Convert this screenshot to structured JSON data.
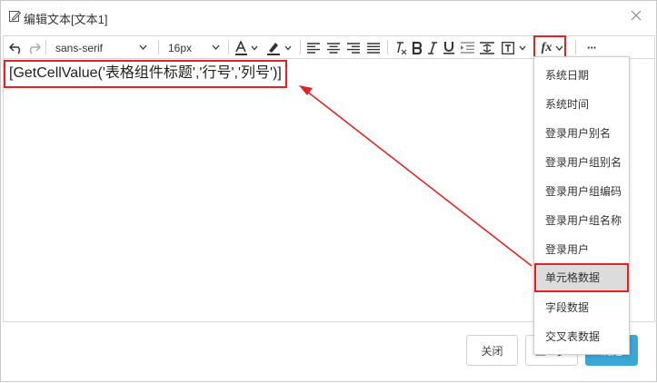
{
  "dialog": {
    "title": "编辑文本[文本1]"
  },
  "toolbar": {
    "font_family": "sans-serif",
    "font_size": "16px",
    "fx_label": "fx",
    "more_label": "···"
  },
  "editor": {
    "content": "[GetCellValue('表格组件标题','行号','列号')]"
  },
  "fx_menu": {
    "items": [
      {
        "label": "系统日期"
      },
      {
        "label": "系统时间"
      },
      {
        "label": "登录用户别名"
      },
      {
        "label": "登录用户组别名"
      },
      {
        "label": "登录用户组编码"
      },
      {
        "label": "登录用户组名称"
      },
      {
        "label": "登录用户"
      },
      {
        "label": "单元格数据",
        "selected": true
      },
      {
        "label": "字段数据"
      },
      {
        "label": "交叉表数据"
      }
    ]
  },
  "footer": {
    "close_label": "关闭",
    "prev_label": "上一步",
    "ok_label": "确定"
  },
  "colors": {
    "annotation": "#e32323",
    "primary_button": "#3aa7d6"
  }
}
